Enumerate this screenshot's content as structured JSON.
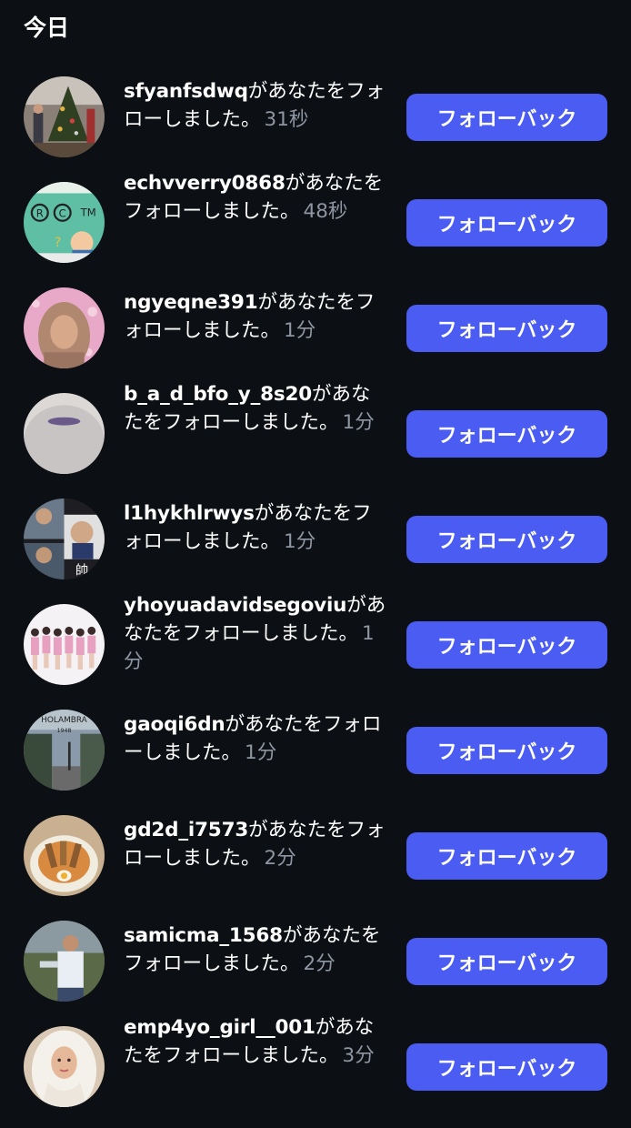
{
  "section_title": "今日",
  "follow_back_label": "フォローバック",
  "notifications": [
    {
      "username": "sfyanfsdwq",
      "message": "があなたをフォローしました。",
      "time": "31秒",
      "avatar": "christmas-tree-photo"
    },
    {
      "username": "echvverry0868",
      "message": "があなたをフォローしました。",
      "time": "48秒",
      "avatar": "trademark-cartoon-photo"
    },
    {
      "username": "ngyeqne391",
      "message": "があなたをフォローしました。",
      "time": "1分",
      "avatar": "woman-hijab-photo"
    },
    {
      "username": "b_a_d_bfo_y_8s20",
      "message": "があなたをフォローしました。",
      "time": "1分",
      "avatar": "blurry-skin-photo"
    },
    {
      "username": "l1hykhlrwys",
      "message": "があなたをフォローしました。",
      "time": "1分",
      "avatar": "collage-men-photo"
    },
    {
      "username": "yhoyuadavidsegoviu",
      "message": "があなたをフォローしました。",
      "time": "1分",
      "avatar": "group-dancers-photo"
    },
    {
      "username": "gaoqi6dn",
      "message": "があなたをフォローしました。",
      "time": "1分",
      "avatar": "holambra-street-photo"
    },
    {
      "username": "gd2d_i7573",
      "message": "があなたをフォローしました。",
      "time": "2分",
      "avatar": "food-bowl-photo"
    },
    {
      "username": "samicma_1568",
      "message": "があなたをフォローしました。",
      "time": "2分",
      "avatar": "man-outdoors-photo"
    },
    {
      "username": "emp4yo_girl__001",
      "message": "があなたをフォローしました。",
      "time": "3分",
      "avatar": "bride-veil-photo"
    }
  ],
  "avatar_logo_text": {
    "holambra": "HOLAMBRA",
    "holambra_year": "1948"
  }
}
